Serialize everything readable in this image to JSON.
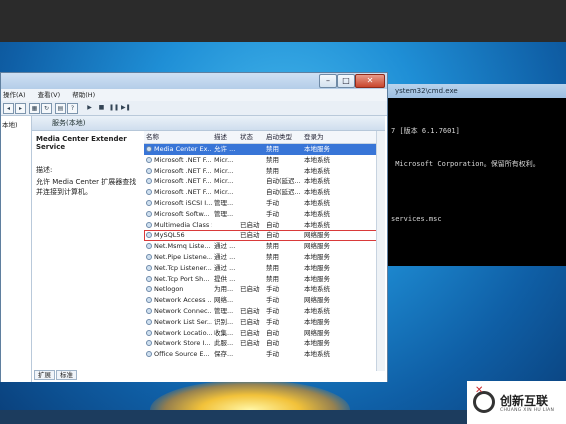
{
  "cmd": {
    "title": "ystem32\\cmd.exe",
    "lines": [
      "7 [版本 6.1.7601]",
      " Microsoft Corporation。保留所有权利。",
      "",
      "services.msc",
      "",
      ""
    ]
  },
  "window": {
    "menu": [
      "操作(A)",
      "查看(V)",
      "帮助(H)"
    ],
    "tree_item": "本地)",
    "header_title": "服务(本地)",
    "desc_title": "Media Center Extender Service",
    "desc_label": "描述:",
    "desc_text": "允许 Media Center 扩展器查找并连接到计算机。",
    "columns": [
      "名称",
      "描述",
      "状态",
      "启动类型",
      "登录为"
    ],
    "rows": [
      [
        "Media Center Ex...",
        "允许 ...",
        "",
        "禁用",
        "本地服务"
      ],
      [
        "Microsoft .NET F...",
        "Micr...",
        "",
        "禁用",
        "本地系统"
      ],
      [
        "Microsoft .NET F...",
        "Micr...",
        "",
        "禁用",
        "本地系统"
      ],
      [
        "Microsoft .NET F...",
        "Micr...",
        "",
        "自动(延迟...",
        "本地系统"
      ],
      [
        "Microsoft .NET F...",
        "Micr...",
        "",
        "自动(延迟...",
        "本地系统"
      ],
      [
        "Microsoft iSCSI I...",
        "管理...",
        "",
        "手动",
        "本地系统"
      ],
      [
        "Microsoft Softw...",
        "管理...",
        "",
        "手动",
        "本地系统"
      ],
      [
        "Multimedia Class Scheduler",
        "",
        "已启动",
        "自动",
        "本地系统"
      ],
      [
        "MySQL56",
        "",
        "已启动",
        "自动",
        "网络服务"
      ],
      [
        "Net.Msmq Liste...",
        "通过 ...",
        "",
        "禁用",
        "网络服务"
      ],
      [
        "Net.Pipe Listene...",
        "通过 ...",
        "",
        "禁用",
        "本地服务"
      ],
      [
        "Net.Tcp Listener...",
        "通过 ...",
        "",
        "禁用",
        "本地服务"
      ],
      [
        "Net.Tcp Port Sh...",
        "提供 ...",
        "",
        "禁用",
        "本地服务"
      ],
      [
        "Netlogon",
        "为用...",
        "已启动",
        "手动",
        "本地系统"
      ],
      [
        "Network Access ...",
        "网络...",
        "",
        "手动",
        "网络服务"
      ],
      [
        "Network Connec...",
        "管理...",
        "已启动",
        "手动",
        "本地系统"
      ],
      [
        "Network List Ser...",
        "识别...",
        "已启动",
        "手动",
        "本地服务"
      ],
      [
        "Network Locatio...",
        "收集...",
        "已启动",
        "自动",
        "网络服务"
      ],
      [
        "Network Store I...",
        "此服...",
        "已启动",
        "自动",
        "本地服务"
      ],
      [
        "Office Source E...",
        "保存...",
        "",
        "手动",
        "本地系统"
      ]
    ],
    "tabs": [
      "扩展",
      "标准"
    ]
  },
  "logo": {
    "name": "创新互联",
    "sub": "CHUANG XIN HU LIAN"
  },
  "colors": {
    "selection": "#3875d7",
    "highlight_box": "#d93a3a",
    "desktop": "#1f8fd6"
  }
}
